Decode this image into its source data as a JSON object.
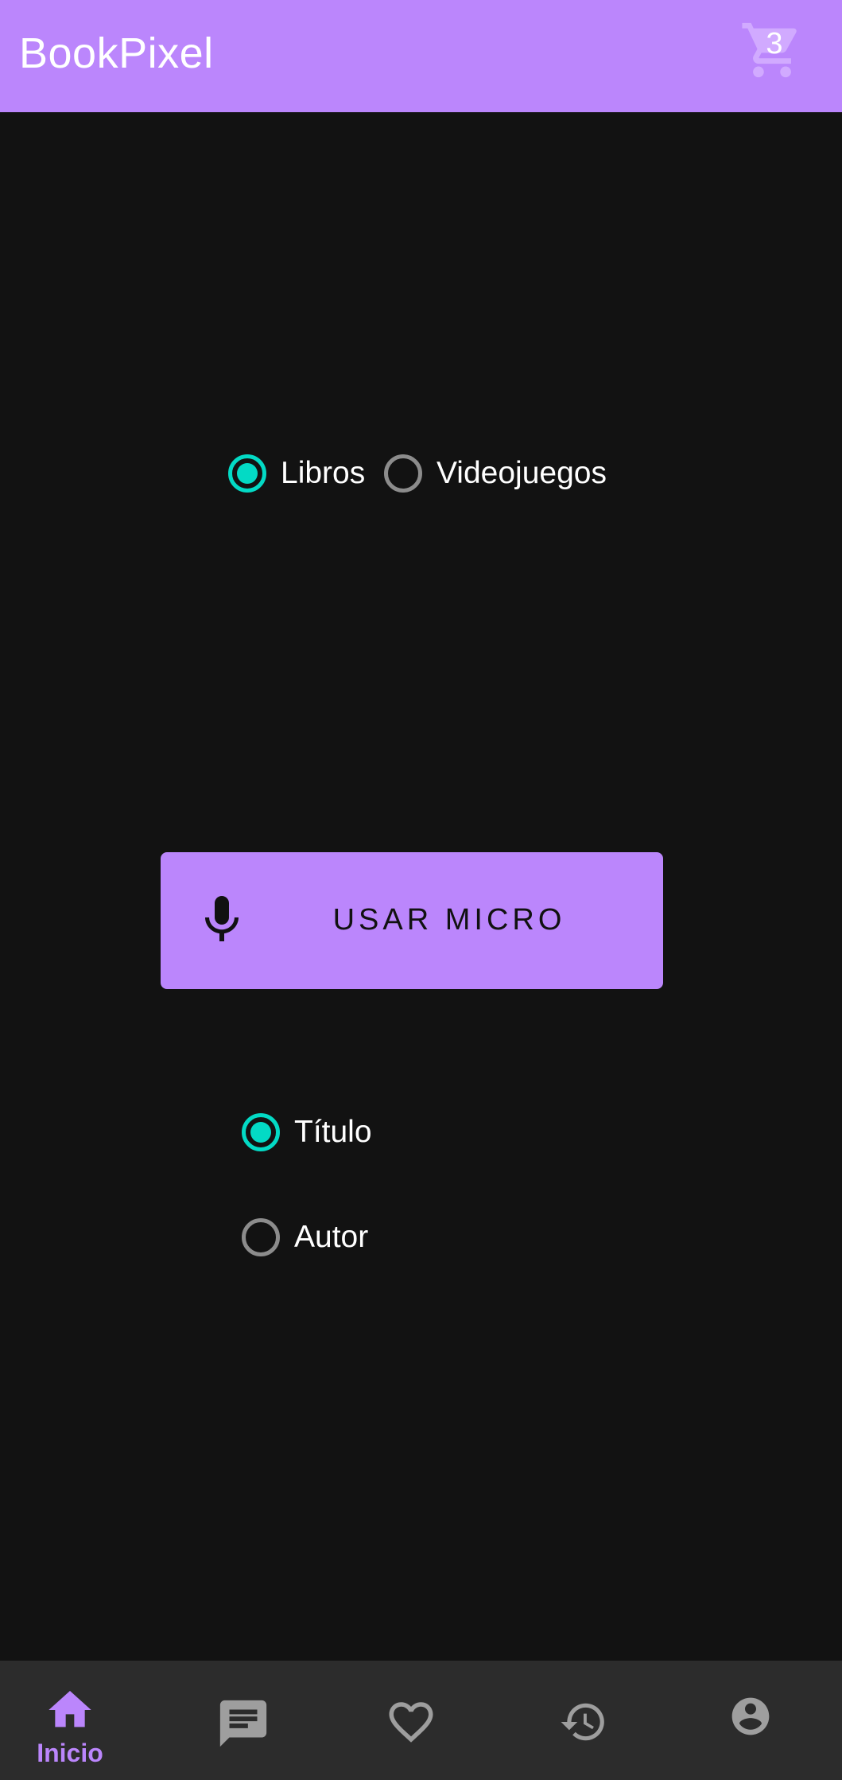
{
  "app_bar": {
    "title": "BookPixel",
    "cart_icon": "shopping-cart-icon",
    "cart_count": "3"
  },
  "category_radio": {
    "options": [
      {
        "label": "Libros",
        "checked": true
      },
      {
        "label": "Videojuegos",
        "checked": false
      }
    ]
  },
  "mic_button": {
    "icon": "microphone-icon",
    "label": "USAR MICRO"
  },
  "search_by_radio": {
    "options": [
      {
        "label": "Título",
        "checked": true
      },
      {
        "label": "Autor",
        "checked": false
      }
    ]
  },
  "bottom_nav": {
    "items": [
      {
        "icon": "home-icon",
        "label": "Inicio",
        "selected": true
      },
      {
        "icon": "chat-icon",
        "selected": false
      },
      {
        "icon": "heart-icon",
        "selected": false
      },
      {
        "icon": "history-icon",
        "selected": false
      },
      {
        "icon": "account-icon",
        "selected": false
      }
    ]
  },
  "colors": {
    "primary": "#bb86fc",
    "accent": "#03dac5",
    "background": "#121212",
    "nav_background": "#2c2c2c",
    "inactive": "#9e9e9e"
  }
}
